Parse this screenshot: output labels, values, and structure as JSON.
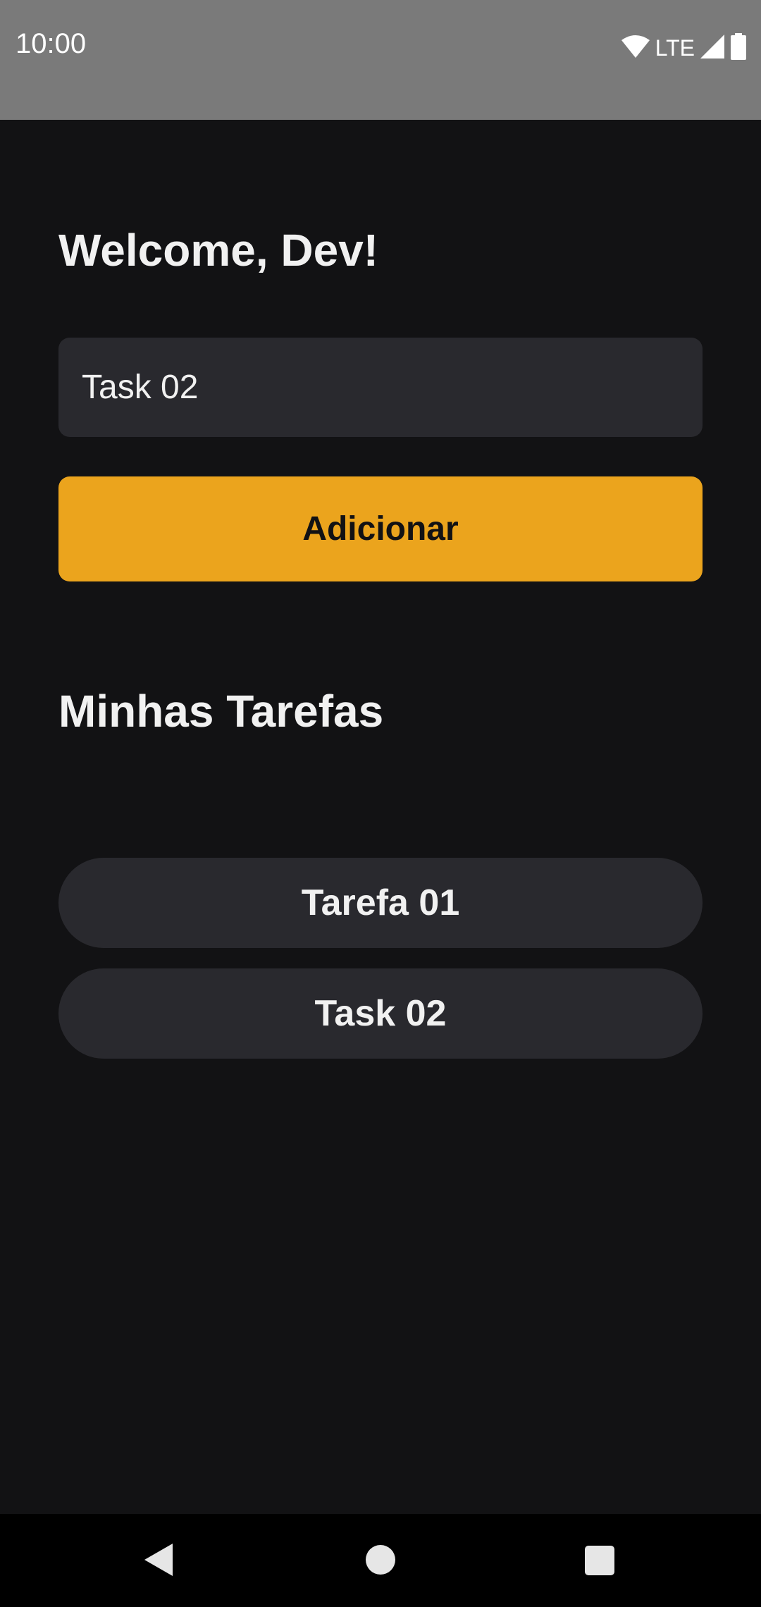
{
  "status_bar": {
    "time": "10:00",
    "network": "LTE",
    "icons": [
      "wifi-icon",
      "signal-icon",
      "battery-icon"
    ]
  },
  "header": {
    "welcome": "Welcome, Dev!"
  },
  "form": {
    "input_value": "Task 02",
    "add_button_label": "Adicionar"
  },
  "tasks": {
    "title": "Minhas Tarefas",
    "items": [
      {
        "label": "Tarefa 01"
      },
      {
        "label": "Task 02"
      }
    ]
  },
  "nav_bar": {
    "icons": [
      "back-icon",
      "home-icon",
      "recents-icon"
    ]
  },
  "colors": {
    "background": "#121214",
    "surface": "#29292e",
    "accent": "#eba41d",
    "text": "#f1f1f1",
    "status_bar": "#7a7a7a"
  }
}
